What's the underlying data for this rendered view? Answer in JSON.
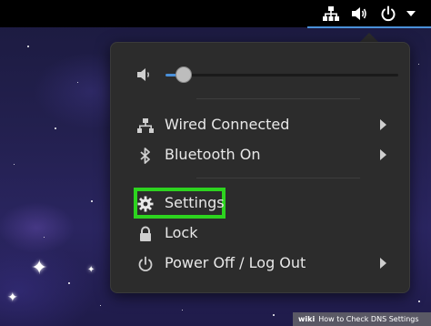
{
  "topbar": {
    "icons": [
      "network-wired-icon",
      "volume-icon",
      "power-icon",
      "chevron-down-icon"
    ]
  },
  "menu": {
    "volume": {
      "icon": "volume-low-icon",
      "level": 0.08
    },
    "items": [
      {
        "label": "Wired Connected",
        "icon": "network-wired-icon",
        "submenu": true
      },
      {
        "label": "Bluetooth On",
        "icon": "bluetooth-icon",
        "submenu": true
      },
      {
        "label": "Settings",
        "icon": "gear-icon",
        "submenu": false,
        "highlighted": true
      },
      {
        "label": "Lock",
        "icon": "lock-icon",
        "submenu": false
      },
      {
        "label": "Power Off / Log Out",
        "icon": "power-icon",
        "submenu": true
      }
    ]
  },
  "watermark": {
    "brand": "wiki",
    "text": "How to Check DNS Settings"
  },
  "colors": {
    "highlight": "#2dd41f",
    "accent": "#4a90d9",
    "menu_bg": "#2c2c2c"
  }
}
